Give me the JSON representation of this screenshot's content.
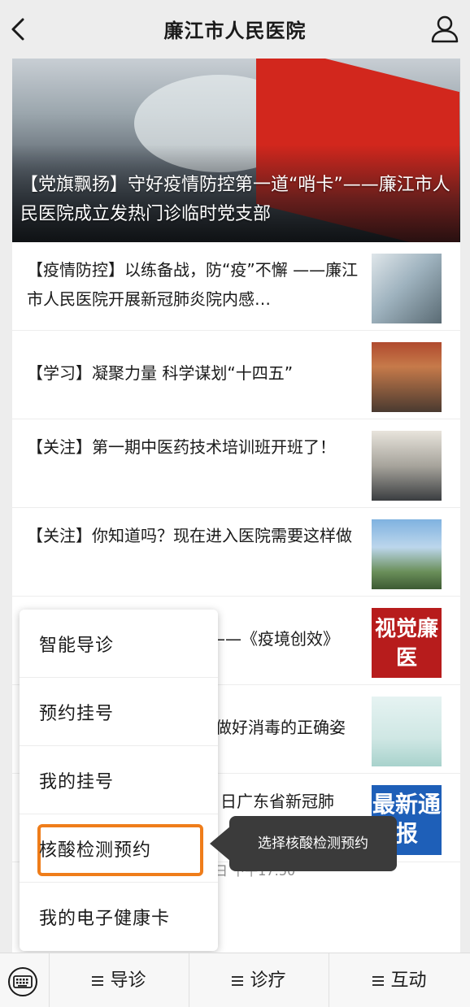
{
  "header": {
    "title": "廉江市人民医院"
  },
  "hero": {
    "title": "【党旗飘扬】守好疫情防控第一道“哨卡”——廉江市人民医院成立发热门诊临时党支部"
  },
  "news": [
    {
      "title": "【疫情防控】以练备战，防“疫”不懈 ——廉江市人民医院开展新冠肺炎院内感…"
    },
    {
      "title": "【学习】凝聚力量 科学谋划“十四五”"
    },
    {
      "title": "【关注】第一期中医药技术培训班开班了！"
    },
    {
      "title": "【关注】你知道吗？现在进入医院需要这样做"
    },
    {
      "title": "——《疫境创效》",
      "thumb_text": "视觉廉医"
    },
    {
      "title": "做好消毒的正确姿"
    },
    {
      "title": "日广东省新冠肺",
      "thumb_text": "最新通报"
    }
  ],
  "timestamp": "日 下午17:50",
  "popup_menu": {
    "items": [
      "智能导诊",
      "预约挂号",
      "我的挂号",
      "核酸检测预约",
      "我的电子健康卡"
    ],
    "highlight_color": "#ef7d1a"
  },
  "tooltip": {
    "text": "选择核酸检测预约"
  },
  "bottom_nav": {
    "tabs": [
      "导诊",
      "诊疗",
      "互动"
    ]
  },
  "icons": [
    "back-icon",
    "user-icon",
    "keyboard-icon"
  ]
}
